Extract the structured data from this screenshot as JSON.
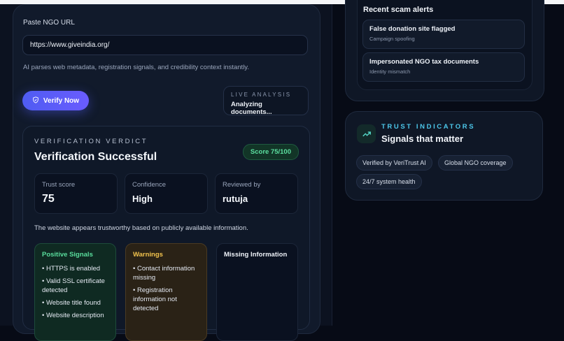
{
  "form": {
    "url_label": "Paste NGO URL",
    "url_value": "https://www.giveindia.org/",
    "helper": "AI parses web metadata, registration signals, and credibility context instantly.",
    "verify_label": "Verify Now"
  },
  "live_analysis": {
    "title": "LIVE ANALYSIS",
    "status": "Analyzing documents..."
  },
  "verdict": {
    "kicker": "VERIFICATION VERDICT",
    "title": "Verification Successful",
    "score_badge": "Score 75/100",
    "stats": [
      {
        "label": "Trust score",
        "value": "75"
      },
      {
        "label": "Confidence",
        "value": "High"
      },
      {
        "label": "Reviewed by",
        "value": "rutuja"
      }
    ],
    "summary": "The website appears trustworthy based on publicly available information.",
    "positive": {
      "title": "Positive Signals",
      "items": [
        "• HTTPS is enabled",
        "• Valid SSL certificate detected",
        "• Website title found",
        "• Website description"
      ]
    },
    "warnings": {
      "title": "Warnings",
      "items": [
        "• Contact information missing",
        "• Registration information not detected"
      ]
    },
    "missing": {
      "title": "Missing Information"
    }
  },
  "alerts": {
    "title": "Recent scam alerts",
    "items": [
      {
        "title": "False donation site flagged",
        "subtitle": "Campaign spoofing"
      },
      {
        "title": "Impersonated NGO tax documents",
        "subtitle": "Identity mismatch"
      }
    ]
  },
  "trust": {
    "kicker": "TRUST INDICATORS",
    "title": "Signals that matter",
    "chips": [
      "Verified by VeriTrust AI",
      "Global NGO coverage",
      "24/7 system health"
    ]
  },
  "colors": {
    "accent": "#5b5cf6",
    "positive": "#59dd9c",
    "warning": "#f1c24d",
    "info": "#4cc7ea"
  },
  "icons": {
    "verify": "shield-icon",
    "trust": "trending-up-icon"
  }
}
